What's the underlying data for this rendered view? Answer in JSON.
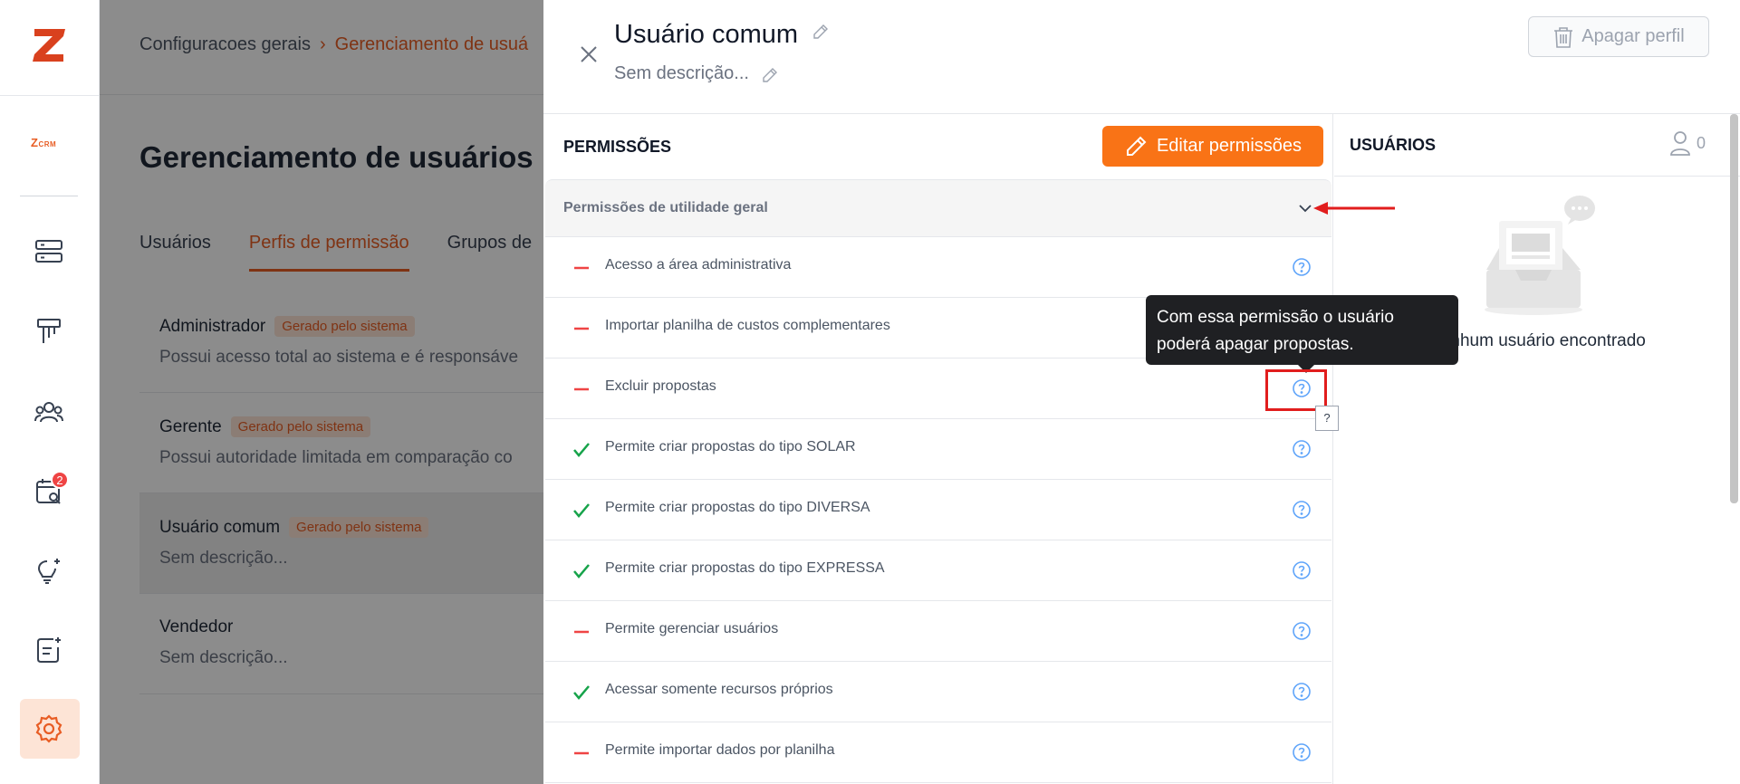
{
  "sidebar": {
    "crm_logo_text": "CRM",
    "crm_logo_prefix": "Z",
    "notification_count": "2"
  },
  "breadcrumb": {
    "root": "Configuracoes gerais",
    "separator": "›",
    "current": "Gerenciamento de usuá"
  },
  "page": {
    "title": "Gerenciamento de usuários"
  },
  "tabs": [
    {
      "label": "Usuários"
    },
    {
      "label": "Perfis de permissão"
    },
    {
      "label": "Grupos de"
    }
  ],
  "profiles": [
    {
      "name": "Administrador",
      "tag": "Gerado pelo sistema",
      "description": "Possui acesso total ao sistema e é responsáve"
    },
    {
      "name": "Gerente",
      "tag": "Gerado pelo sistema",
      "description": "Possui autoridade limitada em comparação co"
    },
    {
      "name": "Usuário comum",
      "tag": "Gerado pelo sistema",
      "description": "Sem descrição..."
    },
    {
      "name": "Vendedor",
      "tag": "",
      "description": "Sem descrição..."
    }
  ],
  "drawer": {
    "title": "Usuário comum",
    "description": "Sem descrição...",
    "delete_button": "Apagar perfil"
  },
  "permissions": {
    "heading": "PERMISSÕES",
    "edit_button": "Editar permissões",
    "group_label": "Permissões de utilidade geral",
    "items": [
      {
        "label": "Acesso a área administrativa",
        "granted": false
      },
      {
        "label": "Importar planilha de custos complementares",
        "granted": false
      },
      {
        "label": "Excluir propostas",
        "granted": false
      },
      {
        "label": "Permite criar propostas do tipo SOLAR",
        "granted": true
      },
      {
        "label": "Permite criar propostas do tipo DIVERSA",
        "granted": true
      },
      {
        "label": "Permite criar propostas do tipo EXPRESSA",
        "granted": true
      },
      {
        "label": "Permite gerenciar usuários",
        "granted": false
      },
      {
        "label": "Acessar somente recursos próprios",
        "granted": true
      },
      {
        "label": "Permite importar dados por planilha",
        "granted": false
      }
    ]
  },
  "users": {
    "heading": "USUÁRIOS",
    "count": "0",
    "empty_message": "Nenhum usuário encontrado"
  },
  "tooltip": {
    "text": "Com essa permissão o usuário poderá apagar propostas."
  },
  "cursor_label": "?",
  "colors": {
    "accent": "#f97316",
    "brand": "#e85d24",
    "granted": "#16a34a",
    "denied": "#ef4444",
    "help_icon": "#60a5fa",
    "annotation": "#e11d1d"
  }
}
